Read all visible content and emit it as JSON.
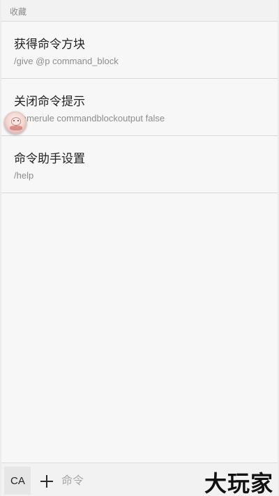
{
  "favorites_header": "收藏",
  "items": [
    {
      "title": "获得命令方块",
      "command": "/give @p command_block"
    },
    {
      "title": "关闭命令提示",
      "command": "/gamerule commandblockoutput false"
    },
    {
      "title": "命令助手设置",
      "command": "/help"
    }
  ],
  "bottom_bar": {
    "ca_label": "CA",
    "plus_icon": "plus-icon",
    "input_placeholder": "命令",
    "input_value": ""
  },
  "watermark": "大玩家",
  "floating_avatar_icon": "avatar-icon"
}
